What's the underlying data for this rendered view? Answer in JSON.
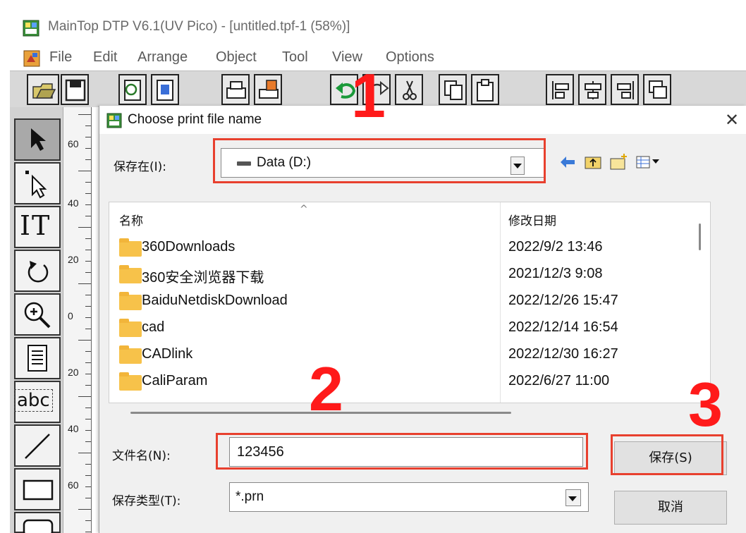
{
  "app": {
    "title": "MainTop DTP V6.1(UV Pico) - [untitled.tpf-1 (58%)]",
    "menu": [
      "File",
      "Edit",
      "Arrange",
      "Object",
      "Tool",
      "View",
      "Options"
    ],
    "toolbar_icons": [
      "open-icon",
      "save-icon",
      "import-icon",
      "export-icon",
      "print-icon",
      "print-setup-icon",
      "undo-icon",
      "redo-icon",
      "cut-icon",
      "copy-icon",
      "paste-icon",
      "align-left-icon",
      "align-center-icon",
      "align-right-icon",
      "arrange-icon"
    ],
    "tool_icons": [
      "pointer-icon",
      "node-edit-icon",
      "text-icon",
      "rotate-icon",
      "zoom-icon",
      "paragraph-icon",
      "abc-text-icon",
      "line-icon",
      "rectangle-icon",
      "rounded-rect-icon"
    ],
    "tool_text": {
      "text_tool": "IT",
      "abc_tool": "abc"
    },
    "ruler_numbers": [
      "60",
      "40",
      "20",
      "0",
      "20",
      "40",
      "60"
    ]
  },
  "dialog": {
    "title": "Choose print file name",
    "close_glyph": "✕",
    "save_in_label": "保存在(I):",
    "save_in_value": "Data (D:)",
    "columns": {
      "name": "名称",
      "modified": "修改日期"
    },
    "files": [
      {
        "name": "360Downloads",
        "date": "2022/9/2 13:46"
      },
      {
        "name": "360安全浏览器下载",
        "date": "2021/12/3 9:08"
      },
      {
        "name": "BaiduNetdiskDownload",
        "date": "2022/12/26 15:47"
      },
      {
        "name": "cad",
        "date": "2022/12/14 16:54"
      },
      {
        "name": "CADlink",
        "date": "2022/12/30 16:27"
      },
      {
        "name": "CaliParam",
        "date": "2022/6/27 11:00"
      }
    ],
    "file_name_label": "文件名(N):",
    "file_name_value": "123456",
    "file_type_label": "保存类型(T):",
    "file_type_value": "*.prn",
    "save_button": "保存(S)",
    "cancel_button": "取消"
  },
  "annotations": {
    "step1": "1",
    "step2": "2",
    "step3": "3",
    "color": "#e8402e"
  }
}
